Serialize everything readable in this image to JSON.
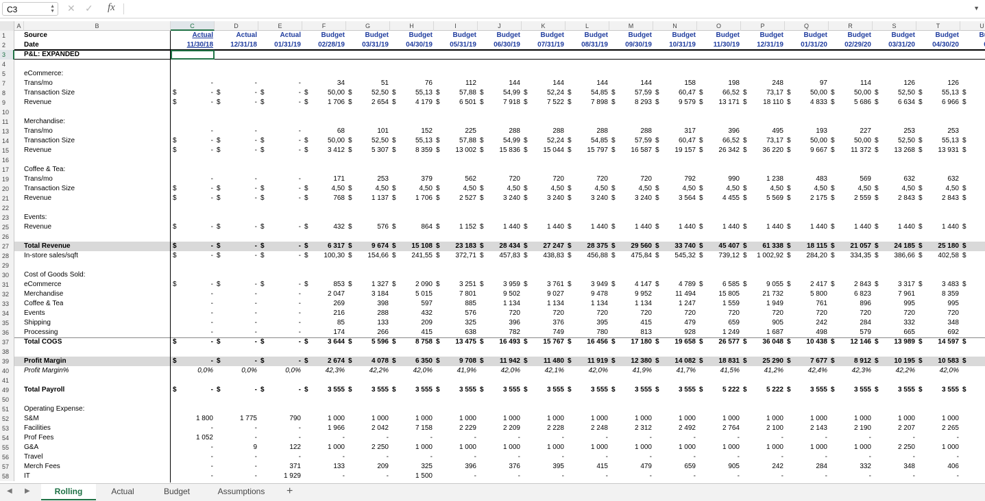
{
  "app": {
    "name_box": "C3",
    "formula": "",
    "fx_label": "fx"
  },
  "columns": [
    "A",
    "B",
    "C",
    "D",
    "E",
    "F",
    "G",
    "H",
    "I",
    "J",
    "K",
    "L",
    "M",
    "N",
    "O",
    "P",
    "Q",
    "R",
    "S",
    "T",
    "U"
  ],
  "sheets": [
    "Rolling",
    "Actual",
    "Budget",
    "Assumptions"
  ],
  "active_sheet": "Rolling",
  "rows": [
    {
      "n": "1",
      "label": "Source",
      "bold": true,
      "vals": [
        "Actual",
        "Actual",
        "Actual",
        "Budget",
        "Budget",
        "Budget",
        "Budget",
        "Budget",
        "Budget",
        "Budget",
        "Budget",
        "Budget",
        "Budget",
        "Budget",
        "Budget",
        "Budget",
        "Budget",
        "Budget",
        "Budget",
        "Budg"
      ],
      "hdr": true
    },
    {
      "n": "2",
      "label": "Date",
      "bold": true,
      "vals": [
        "11/30/18",
        "12/31/18",
        "01/31/19",
        "02/28/19",
        "03/31/19",
        "04/30/19",
        "05/31/19",
        "06/30/19",
        "07/31/19",
        "08/31/19",
        "09/30/19",
        "10/31/19",
        "11/30/19",
        "12/31/19",
        "01/31/20",
        "02/29/20",
        "03/31/20",
        "04/30/20",
        "05/31/"
      ],
      "hdr": true
    },
    {
      "n": "3",
      "label": "P&L: EXPANDED",
      "bold": true,
      "vals": []
    },
    {
      "n": "4",
      "label": "",
      "vals": []
    },
    {
      "n": "5",
      "label": "eCommerce:",
      "vals": []
    },
    {
      "n": "7",
      "label": "Trans/mo",
      "vals": [
        "-",
        "-",
        "-",
        "34",
        "51",
        "76",
        "112",
        "144",
        "144",
        "144",
        "144",
        "158",
        "198",
        "248",
        "97",
        "114",
        "126",
        "126",
        "14"
      ]
    },
    {
      "n": "8",
      "label": "Transaction Size",
      "dol": true,
      "vals": [
        "-",
        "-",
        "-",
        "50,00",
        "52,50",
        "55,13",
        "57,88",
        "54,99",
        "52,24",
        "54,85",
        "57,59",
        "60,47",
        "66,52",
        "73,17",
        "50,00",
        "50,00",
        "52,50",
        "55,13",
        "57,8"
      ]
    },
    {
      "n": "9",
      "label": "Revenue",
      "dol": true,
      "vals": [
        "-",
        "-",
        "-",
        "1 706",
        "2 654",
        "4 179",
        "6 501",
        "7 918",
        "7 522",
        "7 898",
        "8 293",
        "9 579",
        "13 171",
        "18 110",
        "4 833",
        "5 686",
        "6 634",
        "6 966",
        "8 12"
      ]
    },
    {
      "n": "10",
      "label": "",
      "vals": []
    },
    {
      "n": "11",
      "label": "Merchandise:",
      "vals": []
    },
    {
      "n": "13",
      "label": "Trans/mo",
      "vals": [
        "-",
        "-",
        "-",
        "68",
        "101",
        "152",
        "225",
        "288",
        "288",
        "288",
        "288",
        "317",
        "396",
        "495",
        "193",
        "227",
        "253",
        "253",
        "28"
      ]
    },
    {
      "n": "14",
      "label": "Transaction Size",
      "dol": true,
      "vals": [
        "-",
        "-",
        "-",
        "50,00",
        "52,50",
        "55,13",
        "57,88",
        "54,99",
        "52,24",
        "54,85",
        "57,59",
        "60,47",
        "66,52",
        "73,17",
        "50,00",
        "50,00",
        "52,50",
        "55,13",
        "57,8"
      ]
    },
    {
      "n": "15",
      "label": "Revenue",
      "dol": true,
      "vals": [
        "-",
        "-",
        "-",
        "3 412",
        "5 307",
        "8 359",
        "13 002",
        "15 836",
        "15 044",
        "15 797",
        "16 587",
        "19 157",
        "26 342",
        "36 220",
        "9 667",
        "11 372",
        "13 268",
        "13 931",
        "16 25"
      ]
    },
    {
      "n": "16",
      "label": "",
      "vals": []
    },
    {
      "n": "17",
      "label": "Coffee & Tea:",
      "vals": []
    },
    {
      "n": "19",
      "label": "Trans/mo",
      "vals": [
        "-",
        "-",
        "-",
        "171",
        "253",
        "379",
        "562",
        "720",
        "720",
        "720",
        "720",
        "792",
        "990",
        "1 238",
        "483",
        "569",
        "632",
        "632",
        "70"
      ]
    },
    {
      "n": "20",
      "label": "Transaction Size",
      "dol": true,
      "vals": [
        "-",
        "-",
        "-",
        "4,50",
        "4,50",
        "4,50",
        "4,50",
        "4,50",
        "4,50",
        "4,50",
        "4,50",
        "4,50",
        "4,50",
        "4,50",
        "4,50",
        "4,50",
        "4,50",
        "4,50",
        "4,5"
      ]
    },
    {
      "n": "21",
      "label": "Revenue",
      "dol": true,
      "vals": [
        "-",
        "-",
        "-",
        "768",
        "1 137",
        "1 706",
        "2 527",
        "3 240",
        "3 240",
        "3 240",
        "3 240",
        "3 564",
        "4 455",
        "5 569",
        "2 175",
        "2 559",
        "2 843",
        "2 843",
        "3 15"
      ]
    },
    {
      "n": "22",
      "label": "",
      "vals": []
    },
    {
      "n": "23",
      "label": "Events:",
      "vals": []
    },
    {
      "n": "25",
      "label": "Revenue",
      "dol": true,
      "vals": [
        "-",
        "-",
        "-",
        "432",
        "576",
        "864",
        "1 152",
        "1 440",
        "1 440",
        "1 440",
        "1 440",
        "1 440",
        "1 440",
        "1 440",
        "1 440",
        "1 440",
        "1 440",
        "1 440",
        "1 44"
      ]
    },
    {
      "n": "26",
      "label": "",
      "vals": []
    },
    {
      "n": "27",
      "label": "Total Revenue",
      "bold": true,
      "band": true,
      "dol": true,
      "vals": [
        "-",
        "-",
        "-",
        "6 317",
        "9 674",
        "15 108",
        "23 183",
        "28 434",
        "27 247",
        "28 375",
        "29 560",
        "33 740",
        "45 407",
        "61 338",
        "18 115",
        "21 057",
        "24 185",
        "25 180",
        "28 97"
      ]
    },
    {
      "n": "28",
      "label": "In-store sales/sqft",
      "dol": true,
      "vals": [
        "-",
        "-",
        "-",
        "100,30",
        "154,66",
        "241,55",
        "372,71",
        "457,83",
        "438,83",
        "456,88",
        "475,84",
        "545,32",
        "739,12",
        "1 002,92",
        "284,20",
        "334,35",
        "386,66",
        "402,58",
        "465,8"
      ]
    },
    {
      "n": "29",
      "label": "",
      "vals": []
    },
    {
      "n": "30",
      "label": "Cost of Goods Sold:",
      "vals": []
    },
    {
      "n": "31",
      "label": "eCommerce",
      "dol": true,
      "vals": [
        "-",
        "-",
        "-",
        "853",
        "1 327",
        "2 090",
        "3 251",
        "3 959",
        "3 761",
        "3 949",
        "4 147",
        "4 789",
        "6 585",
        "9 055",
        "2 417",
        "2 843",
        "3 317",
        "3 483",
        "4 06"
      ]
    },
    {
      "n": "32",
      "label": "Merchandise",
      "vals": [
        "-",
        "-",
        "-",
        "2 047",
        "3 184",
        "5 015",
        "7 801",
        "9 502",
        "9 027",
        "9 478",
        "9 952",
        "11 494",
        "15 805",
        "21 732",
        "5 800",
        "6 823",
        "7 961",
        "8 359",
        "9 75"
      ]
    },
    {
      "n": "33",
      "label": "Coffee & Tea",
      "vals": [
        "-",
        "-",
        "-",
        "269",
        "398",
        "597",
        "885",
        "1 134",
        "1 134",
        "1 134",
        "1 134",
        "1 247",
        "1 559",
        "1 949",
        "761",
        "896",
        "995",
        "995",
        "1 10"
      ]
    },
    {
      "n": "34",
      "label": "Events",
      "vals": [
        "-",
        "-",
        "-",
        "216",
        "288",
        "432",
        "576",
        "720",
        "720",
        "720",
        "720",
        "720",
        "720",
        "720",
        "720",
        "720",
        "720",
        "720",
        "72"
      ]
    },
    {
      "n": "35",
      "label": "Shipping",
      "vals": [
        "-",
        "-",
        "-",
        "85",
        "133",
        "209",
        "325",
        "396",
        "376",
        "395",
        "415",
        "479",
        "659",
        "905",
        "242",
        "284",
        "332",
        "348",
        "40"
      ]
    },
    {
      "n": "36",
      "label": "Processing",
      "vals": [
        "-",
        "-",
        "-",
        "174",
        "266",
        "415",
        "638",
        "782",
        "749",
        "780",
        "813",
        "928",
        "1 249",
        "1 687",
        "498",
        "579",
        "665",
        "692",
        "79"
      ]
    },
    {
      "n": "37",
      "label": "Total COGS",
      "bold": true,
      "dol": true,
      "vals": [
        "-",
        "-",
        "-",
        "3 644",
        "5 596",
        "8 758",
        "13 475",
        "16 493",
        "15 767",
        "16 456",
        "17 180",
        "19 658",
        "26 577",
        "36 048",
        "10 438",
        "12 146",
        "13 989",
        "14 597",
        "16 84"
      ]
    },
    {
      "n": "38",
      "label": "",
      "vals": []
    },
    {
      "n": "39",
      "label": "Profit Margin",
      "bold": true,
      "band": true,
      "dol": true,
      "vals": [
        "-",
        "-",
        "-",
        "2 674",
        "4 078",
        "6 350",
        "9 708",
        "11 942",
        "11 480",
        "11 919",
        "12 380",
        "14 082",
        "18 831",
        "25 290",
        "7 677",
        "8 912",
        "10 195",
        "10 583",
        "12 13"
      ]
    },
    {
      "n": "40",
      "label": "Profit Margin%",
      "ital": true,
      "vals": [
        "0,0%",
        "0,0%",
        "0,0%",
        "42,3%",
        "42,2%",
        "42,0%",
        "41,9%",
        "42,0%",
        "42,1%",
        "42,0%",
        "41,9%",
        "41,7%",
        "41,5%",
        "41,2%",
        "42,4%",
        "42,3%",
        "42,2%",
        "42,0%",
        "41,9"
      ]
    },
    {
      "n": "41",
      "label": "",
      "vals": []
    },
    {
      "n": "49",
      "label": "Total Payroll",
      "bold": true,
      "dol": true,
      "vals": [
        "-",
        "-",
        "-",
        "3 555",
        "3 555",
        "3 555",
        "3 555",
        "3 555",
        "3 555",
        "3 555",
        "3 555",
        "3 555",
        "5 222",
        "5 222",
        "3 555",
        "3 555",
        "3 555",
        "3 555",
        "3 55"
      ]
    },
    {
      "n": "50",
      "label": "",
      "vals": []
    },
    {
      "n": "51",
      "label": "Operating Expense:",
      "vals": []
    },
    {
      "n": "52",
      "label": "S&M",
      "vals": [
        "1 800",
        "1 775",
        "790",
        "1 000",
        "1 000",
        "1 000",
        "1 000",
        "1 000",
        "1 000",
        "1 000",
        "1 000",
        "1 000",
        "1 000",
        "1 000",
        "1 000",
        "1 000",
        "1 000",
        "1 000",
        "1 00"
      ]
    },
    {
      "n": "53",
      "label": "Facilities",
      "vals": [
        "-",
        "-",
        "-",
        "1 966",
        "2 042",
        "7 158",
        "2 229",
        "2 209",
        "2 228",
        "2 248",
        "2 312",
        "2 492",
        "2 764",
        "2 100",
        "2 143",
        "2 190",
        "2 207",
        "2 265",
        "2 25"
      ]
    },
    {
      "n": "54",
      "label": "Prof Fees",
      "vals": [
        "1 052",
        "-",
        "-",
        "-",
        "-",
        "-",
        "-",
        "-",
        "-",
        "-",
        "-",
        "-",
        "-",
        "-",
        "-",
        "-",
        "-",
        "-",
        "-"
      ]
    },
    {
      "n": "55",
      "label": "G&A",
      "vals": [
        "-",
        "9",
        "122",
        "1 000",
        "2 250",
        "1 000",
        "1 000",
        "1 000",
        "1 000",
        "1 000",
        "1 000",
        "1 000",
        "1 000",
        "1 000",
        "1 000",
        "1 000",
        "2 250",
        "1 000",
        "1 00"
      ]
    },
    {
      "n": "56",
      "label": "Travel",
      "vals": [
        "-",
        "-",
        "-",
        "-",
        "-",
        "-",
        "-",
        "-",
        "-",
        "-",
        "-",
        "-",
        "-",
        "-",
        "-",
        "-",
        "-",
        "-",
        "-"
      ]
    },
    {
      "n": "57",
      "label": "Merch Fees",
      "vals": [
        "-",
        "-",
        "371",
        "133",
        "209",
        "325",
        "396",
        "376",
        "395",
        "415",
        "479",
        "659",
        "905",
        "242",
        "284",
        "332",
        "348",
        "406",
        "39"
      ]
    },
    {
      "n": "58",
      "label": "IT",
      "vals": [
        "-",
        "-",
        "1 929",
        "-",
        "-",
        "1 500",
        "-",
        "-",
        "-",
        "-",
        "-",
        "-",
        "-",
        "-",
        "-",
        "-",
        "-",
        "-",
        "-"
      ]
    }
  ]
}
